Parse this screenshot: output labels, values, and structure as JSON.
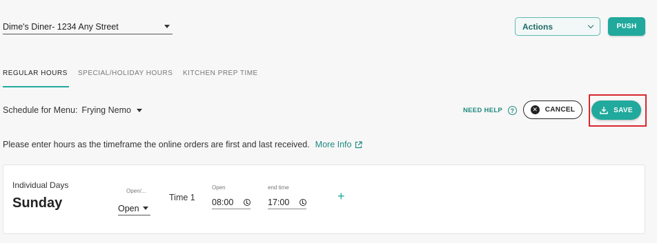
{
  "header": {
    "location": "Dime's Diner-  1234 Any Street",
    "actions_label": "Actions",
    "push_label": "PUSH"
  },
  "tabs": [
    {
      "label": "REGULAR HOURS",
      "active": true
    },
    {
      "label": "SPECIAL/HOLIDAY HOURS",
      "active": false
    },
    {
      "label": "KITCHEN PREP TIME",
      "active": false
    }
  ],
  "schedule": {
    "label": "Schedule for Menu:",
    "menu": "Frying Nemo"
  },
  "toolbar": {
    "need_help": "NEED HELP",
    "cancel_label": "CANCEL",
    "save_label": "SAVE"
  },
  "info": {
    "text": "Please enter hours as the timeframe the online orders are first and last received.",
    "more_info": "More Info"
  },
  "day_card": {
    "group_label": "Individual Days",
    "day": "Sunday",
    "status_label": "Open/...",
    "status_value": "Open",
    "slot_label": "Time 1",
    "open_label": "Open",
    "open_time": "08:00",
    "end_label": "end time",
    "end_time": "17:00",
    "add_symbol": "+"
  },
  "colors": {
    "accent": "#20a99c",
    "accent_dark": "#1e8a80",
    "highlight": "#d9262c"
  }
}
